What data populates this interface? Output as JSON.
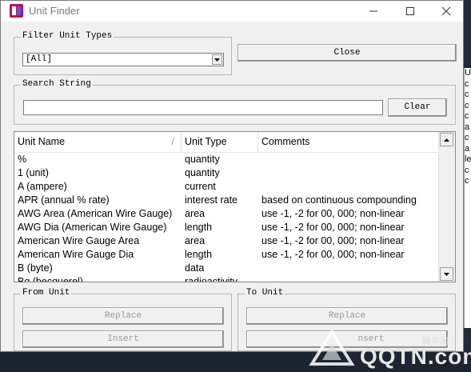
{
  "window": {
    "title": "Unit Finder",
    "minimize_icon": "minimize-icon",
    "maximize_icon": "maximize-icon",
    "close_icon": "close-icon"
  },
  "filter": {
    "label": "Filter Unit Types",
    "selected": "[All]"
  },
  "close_button": "Close",
  "search": {
    "label": "Search String",
    "value": "",
    "clear_label": "Clear"
  },
  "list": {
    "columns": [
      "Unit Name",
      "Unit Type",
      "Comments"
    ],
    "rows": [
      [
        "%",
        "quantity",
        ""
      ],
      [
        "1  (unit)",
        "quantity",
        ""
      ],
      [
        "A  (ampere)",
        "current",
        ""
      ],
      [
        "APR  (annual % rate)",
        "interest rate",
        "based on continuous compounding"
      ],
      [
        "AWG Area  (American Wire Gauge)",
        "area",
        "use -1, -2 for 00, 000; non-linear"
      ],
      [
        "AWG Dia  (American Wire Gauge)",
        "length",
        "use -1, -2 for 00, 000; non-linear"
      ],
      [
        "American Wire Gauge Area",
        "area",
        "use -1, -2 for 00, 000; non-linear"
      ],
      [
        "American Wire Gauge Dia",
        "length",
        "use -1, -2 for 00, 000; non-linear"
      ],
      [
        "B  (byte)",
        "data",
        ""
      ],
      [
        "Bq  (becquerel)",
        "radioactivity",
        ""
      ]
    ]
  },
  "from_unit": {
    "label": "From Unit",
    "replace": "Replace",
    "insert": "Insert"
  },
  "to_unit": {
    "label": "To Unit",
    "replace": "Replace",
    "insert": "nsert"
  },
  "background_window": {
    "letters": [
      "U",
      "c",
      "c",
      "c",
      "c",
      "a",
      "c",
      "a",
      "le",
      "c",
      "c"
    ]
  },
  "watermark": {
    "text": "QQTN.com",
    "small": "腾牛网"
  },
  "colors": {
    "window_bg": "#f0f0f0",
    "titlebar_bg": "#ffffff",
    "desktop_bg": "#1f2a36"
  }
}
